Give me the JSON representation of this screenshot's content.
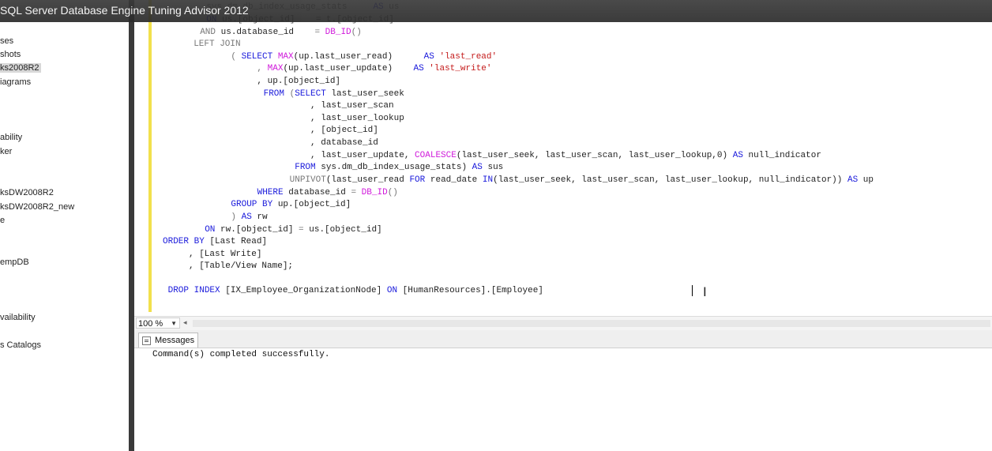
{
  "window": {
    "title": "SQL Server Database Engine Tuning Advisor 2012"
  },
  "object_explorer": {
    "items": [
      {
        "label": "ses"
      },
      {
        "label": "shots"
      },
      {
        "label": "ks2008R2",
        "selected": true
      },
      {
        "label": "iagrams"
      },
      {
        "label": "ability"
      },
      {
        "label": "ker"
      },
      {
        "label": "ksDW2008R2"
      },
      {
        "label": "ksDW2008R2_new"
      },
      {
        "label": "e"
      },
      {
        "label": "empDB"
      },
      {
        "label": "vailability"
      },
      {
        "label": "s Catalogs"
      }
    ]
  },
  "editor": {
    "lines": [
      [
        {
          "t": "  ",
          "c": ""
        },
        {
          "t": "sys.dm_db_index_usage_stats",
          "c": "gy"
        },
        {
          "t": "     ",
          "c": ""
        },
        {
          "t": "AS",
          "c": "kw"
        },
        {
          "t": " us",
          "c": "gy"
        }
      ],
      [
        {
          "t": "  ",
          "c": ""
        },
        {
          "t": "ON",
          "c": "kw"
        },
        {
          "t": " us.[object_id]    = t.[object_id]",
          "c": "gy"
        }
      ],
      [
        {
          "t": "  ",
          "c": ""
        },
        {
          "t": "AND",
          "c": "op"
        },
        {
          "t": " us.database_id    ",
          "c": ""
        },
        {
          "t": "=",
          "c": "op"
        },
        {
          "t": " ",
          "c": ""
        },
        {
          "t": "DB_ID",
          "c": "fn"
        },
        {
          "t": "()",
          "c": "op"
        }
      ],
      [
        {
          "t": "  ",
          "c": ""
        },
        {
          "t": "LEFT JOIN",
          "c": "op"
        }
      ],
      [
        {
          "t": "    ( ",
          "c": "op"
        },
        {
          "t": "SELECT",
          "c": "kw"
        },
        {
          "t": " ",
          "c": ""
        },
        {
          "t": "MAX",
          "c": "fn"
        },
        {
          "t": "(up.last_user_read)      ",
          "c": ""
        },
        {
          "t": "AS",
          "c": "kw"
        },
        {
          "t": " ",
          "c": ""
        },
        {
          "t": "'last_read'",
          "c": "str"
        }
      ],
      [
        {
          "t": "         , ",
          "c": "op"
        },
        {
          "t": "MAX",
          "c": "fn"
        },
        {
          "t": "(up.last_user_update)    ",
          "c": ""
        },
        {
          "t": "AS",
          "c": "kw"
        },
        {
          "t": " ",
          "c": ""
        },
        {
          "t": "'last_write'",
          "c": "str"
        }
      ],
      [
        {
          "t": "         , up.[object_id]",
          "c": ""
        }
      ],
      [
        {
          "t": "      ",
          "c": ""
        },
        {
          "t": "FROM",
          "c": "kw"
        },
        {
          "t": " (",
          "c": "op"
        },
        {
          "t": "SELECT",
          "c": "kw"
        },
        {
          "t": " last_user_seek",
          "c": ""
        }
      ],
      [
        {
          "t": "               , last_user_scan",
          "c": ""
        }
      ],
      [
        {
          "t": "               , last_user_lookup",
          "c": ""
        }
      ],
      [
        {
          "t": "               , [object_id]",
          "c": ""
        }
      ],
      [
        {
          "t": "               , database_id",
          "c": ""
        }
      ],
      [
        {
          "t": "               , last_user_update, ",
          "c": ""
        },
        {
          "t": "COALESCE",
          "c": "fn"
        },
        {
          "t": "(last_user_seek, last_user_scan, last_user_lookup,0) ",
          "c": ""
        },
        {
          "t": "AS",
          "c": "kw"
        },
        {
          "t": " null_indicator",
          "c": ""
        }
      ],
      [
        {
          "t": "            ",
          "c": ""
        },
        {
          "t": "FROM",
          "c": "kw"
        },
        {
          "t": " sys.dm_db_index_usage_stats) ",
          "c": ""
        },
        {
          "t": "AS",
          "c": "kw"
        },
        {
          "t": " sus",
          "c": ""
        }
      ],
      [
        {
          "t": "           UNPIVOT",
          "c": "op"
        },
        {
          "t": "(last_user_read ",
          "c": ""
        },
        {
          "t": "FOR",
          "c": "kw"
        },
        {
          "t": " read_date ",
          "c": ""
        },
        {
          "t": "IN",
          "c": "kw"
        },
        {
          "t": "(last_user_seek, last_user_scan, last_user_lookup, null_indicator)) ",
          "c": ""
        },
        {
          "t": "AS",
          "c": "kw"
        },
        {
          "t": " up",
          "c": ""
        }
      ],
      [
        {
          "t": "      ",
          "c": ""
        },
        {
          "t": "WHERE",
          "c": "kw"
        },
        {
          "t": " database_id ",
          "c": ""
        },
        {
          "t": "=",
          "c": "op"
        },
        {
          "t": " ",
          "c": ""
        },
        {
          "t": "DB_ID",
          "c": "fn"
        },
        {
          "t": "()",
          "c": "op"
        }
      ],
      [
        {
          "t": "    ",
          "c": ""
        },
        {
          "t": "GROUP BY",
          "c": "kw"
        },
        {
          "t": " up.[object_id]",
          "c": ""
        }
      ],
      [
        {
          "t": "    ) ",
          "c": "op"
        },
        {
          "t": "AS",
          "c": "kw"
        },
        {
          "t": " rw",
          "c": ""
        }
      ],
      [
        {
          "t": "  ",
          "c": ""
        },
        {
          "t": "ON",
          "c": "kw"
        },
        {
          "t": " rw.[object_id] ",
          "c": ""
        },
        {
          "t": "=",
          "c": "op"
        },
        {
          "t": " us.[object_id]",
          "c": ""
        }
      ],
      [
        {
          "t": "ORDER BY",
          "c": "kw"
        },
        {
          "t": " [Last Read]",
          "c": ""
        }
      ],
      [
        {
          "t": "     , [Last Write]",
          "c": ""
        }
      ],
      [
        {
          "t": "     , [Table/View Name];",
          "c": ""
        }
      ],
      [
        {
          "t": "",
          "c": ""
        }
      ],
      [
        {
          "t": " ",
          "c": ""
        },
        {
          "t": "DROP INDEX",
          "c": "kw"
        },
        {
          "t": " [IX_Employee_OrganizationNode] ",
          "c": ""
        },
        {
          "t": "ON",
          "c": "kw"
        },
        {
          "t": " [HumanResources].[Employee]",
          "c": ""
        }
      ]
    ]
  },
  "status": {
    "zoom": "100 %"
  },
  "results": {
    "tab_label": "Messages",
    "message": "Command(s) completed successfully."
  },
  "icons": {
    "messages_tab": "messages-icon",
    "text_cursor": "i-beam-cursor-icon"
  },
  "colors": {
    "keyword": "#1a1adb",
    "function": "#d01adb",
    "string": "#c41a1a",
    "change_marker": "#f2e04c"
  }
}
